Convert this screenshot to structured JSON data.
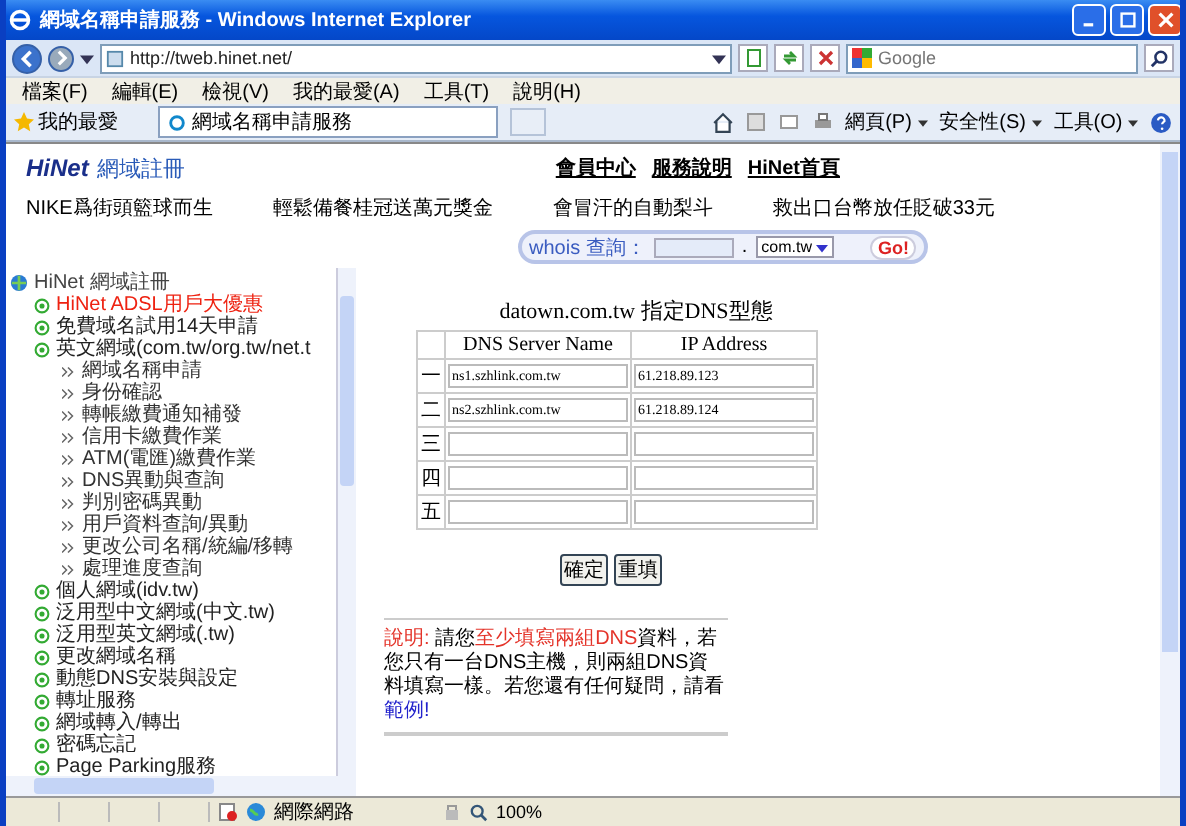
{
  "window": {
    "title": "網域名稱申請服務 - Windows Internet Explorer"
  },
  "address_bar": {
    "url": "http://tweb.hinet.net/"
  },
  "search": {
    "placeholder": "Google"
  },
  "menu": [
    "檔案(F)",
    "編輯(E)",
    "檢視(V)",
    "我的最愛(A)",
    "工具(T)",
    "說明(H)"
  ],
  "favorites": {
    "label": "我的最愛"
  },
  "tabs": [
    {
      "label": "網域名稱申請服務",
      "selected": true
    }
  ],
  "command_bar": [
    "網頁(P)",
    "安全性(S)",
    "工具(O)"
  ],
  "site": {
    "logo": "HiNet",
    "logo_subtitle": "網域註冊",
    "top_links": [
      "會員中心",
      "服務說明",
      "HiNet首頁"
    ],
    "news": [
      "NIKE爲街頭籃球而生",
      "輕鬆備餐桂冠送萬元獎金",
      "會冒汗的自動梨斗",
      "救出口台幣放任貶破33元"
    ],
    "whois": {
      "label": "whois 查詢：",
      "dot": ".",
      "tld": "com.tw",
      "button": "Go!"
    }
  },
  "sidebar": {
    "root": "HiNet 網域註冊",
    "items": [
      {
        "label": "HiNet ADSL用戶大優惠",
        "highlighted": true
      },
      {
        "label": "免費域名試用14天申請",
        "highlighted": false
      },
      {
        "label": "英文網域(com.tw/org.tw/net.t",
        "highlighted": false,
        "children": [
          "網域名稱申請",
          "身份確認",
          "轉帳繳費通知補發",
          "信用卡繳費作業",
          "ATM(電匯)繳費作業",
          "DNS異動與查詢",
          "判別密碼異動",
          "用戶資料查詢/異動",
          "更改公司名稱/統編/移轉",
          "處理進度查詢"
        ]
      },
      {
        "label": "個人網域(idv.tw)",
        "highlighted": false
      },
      {
        "label": "泛用型中文網域(中文.tw)",
        "highlighted": false
      },
      {
        "label": "泛用型英文網域(.tw)",
        "highlighted": false
      },
      {
        "label": "更改網域名稱",
        "highlighted": false
      },
      {
        "label": "動態DNS安裝與設定",
        "highlighted": false
      },
      {
        "label": "轉址服務",
        "highlighted": false
      },
      {
        "label": "網域轉入/轉出",
        "highlighted": false
      },
      {
        "label": "密碼忘記",
        "highlighted": false
      },
      {
        "label": "Page Parking服務",
        "highlighted": false
      }
    ]
  },
  "form": {
    "title": "datown.com.tw 指定DNS型態",
    "columns": [
      "DNS Server Name",
      "IP Address"
    ],
    "rows": [
      {
        "label": "一",
        "name": "ns1.szhlink.com.tw",
        "ip": "61.218.89.123"
      },
      {
        "label": "二",
        "name": "ns2.szhlink.com.tw",
        "ip": "61.218.89.124"
      },
      {
        "label": "三"
      },
      {
        "label": "四"
      },
      {
        "label": "五"
      }
    ],
    "buttons": [
      "確定",
      "重填"
    ]
  },
  "note": {
    "parts": [
      {
        "kind": "label",
        "text": "說明:"
      },
      {
        "kind": "text",
        "text": " 請您"
      },
      {
        "kind": "emphasis",
        "text": "至少填寫兩組DNS"
      },
      {
        "kind": "text",
        "text": "資料，若您只有一台DNS主機，則兩組DNS資料填寫一樣。若您還有任何疑問，請看"
      },
      {
        "kind": "link",
        "text": "範例!"
      }
    ]
  },
  "status_bar": {
    "zone": "網際網路",
    "zoom": "100%"
  }
}
